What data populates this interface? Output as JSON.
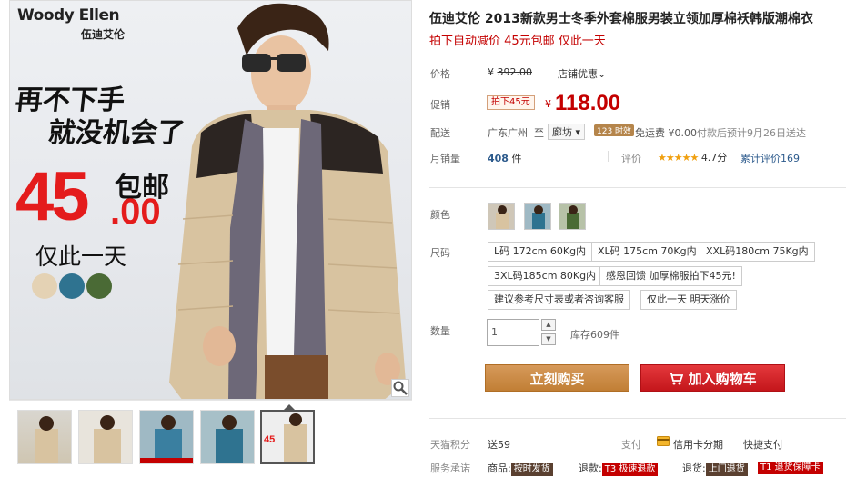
{
  "hero": {
    "brand": "Woody Ellen",
    "brand_sub": "伍迪艾伦",
    "promo_line1": "再不下手",
    "promo_line2": "就没机会了",
    "promo_price_int": "45",
    "promo_price_dec": ".00",
    "promo_package": "包邮",
    "promo_oneday": "仅此一天",
    "swatch_colors": [
      "#e4d2b4",
      "#2f7390",
      "#4a6a35"
    ]
  },
  "product": {
    "title": "伍迪艾伦 2013新款男士冬季外套棉服男装立领加厚棉袄韩版潮棉衣",
    "subtitle": "拍下自动减价 45元包邮 仅此一天"
  },
  "price": {
    "label": "价格",
    "currency": "¥",
    "original": "392.00",
    "shop_discount": "店铺优惠",
    "promo_label": "促销",
    "promo_tag": "拍下45元",
    "promo_currency": "¥",
    "promo_price": "118.00"
  },
  "delivery": {
    "label": "配送",
    "from": "广东广州",
    "to_word": "至",
    "to_city": "廊坊",
    "badge": "123 时效",
    "freight": "免运费 ¥0.00",
    "estimate": "付款后预计9月26日送达"
  },
  "sales": {
    "label": "月销量",
    "count": "408",
    "unit": "件",
    "rating_label": "评价",
    "stars": "★★★★★",
    "rating": "4.7分",
    "total_label": "累计评价",
    "total_count": "169"
  },
  "options": {
    "color_label": "颜色",
    "size_label": "尺码",
    "sizes": [
      "L码 172cm 60Kg内",
      "XL码 175cm 70Kg内",
      "XXL码180cm 75Kg内",
      "3XL码185cm 80Kg内",
      "感恩回馈 加厚棉服拍下45元!",
      "建议参考尺寸表或者咨询客服",
      "仅此一天 明天涨价"
    ],
    "qty_label": "数量",
    "qty_value": "1",
    "stock": "库存609件"
  },
  "actions": {
    "buy": "立刻购买",
    "cart": "加入购物车"
  },
  "footer": {
    "points_label": "天猫积分",
    "points": "送59",
    "pay_label": "支付",
    "pay_card": "信用卡分期",
    "pay_fast": "快捷支付",
    "service_label": "服务承诺",
    "goods": "商品:",
    "goods_tag": "按时发货",
    "refund": "退款:",
    "refund_tag": "T3 极速退款",
    "return": "退货:",
    "return_tag": "上门退货",
    "guarantee_tag": "T1 退货保障卡"
  }
}
